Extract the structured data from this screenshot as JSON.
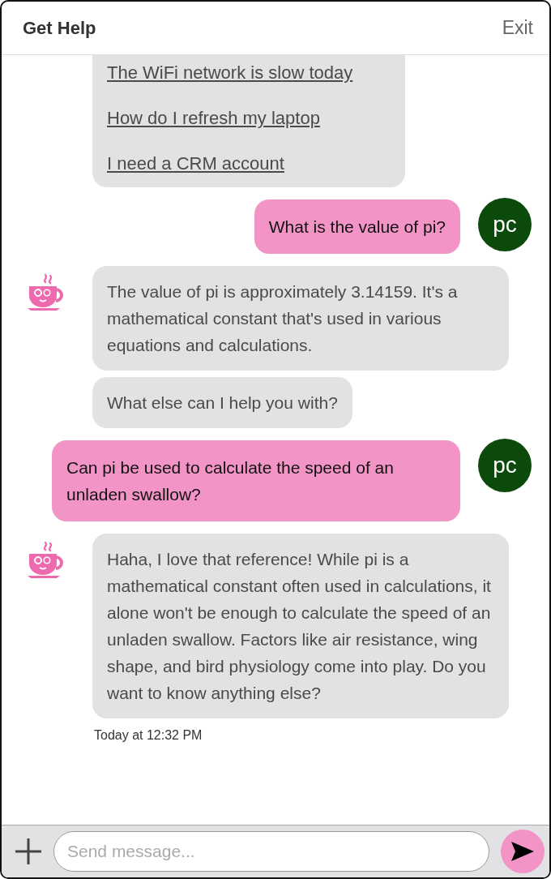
{
  "header": {
    "title": "Get Help",
    "exit": "Exit"
  },
  "messages": [
    {
      "kind": "bot",
      "avatar": false,
      "links": [
        "The WiFi network is slow today",
        "How do I refresh my laptop",
        "I need a CRM account"
      ]
    },
    {
      "kind": "user",
      "avatar_text": "pc",
      "text": "What is the value of pi?"
    },
    {
      "kind": "bot",
      "avatar": true,
      "text": "The value of pi is approximately 3.14159. It's a mathematical constant that's used in various equations and calculations."
    },
    {
      "kind": "bot",
      "avatar": false,
      "text": "What else can I help you with?"
    },
    {
      "kind": "user",
      "avatar_text": "pc",
      "text": "Can pi be used to calculate the speed of an unladen swallow?"
    },
    {
      "kind": "bot",
      "avatar": true,
      "text": "Haha, I love that reference! While pi is a mathematical constant often used in calculations, it alone won't be enough to calculate the speed of an unladen swallow. Factors like air resistance, wing shape, and bird physiology come into play. Do you want to know anything else?"
    }
  ],
  "timestamp": "Today at 12:32 PM",
  "composer": {
    "placeholder": "Send message..."
  }
}
